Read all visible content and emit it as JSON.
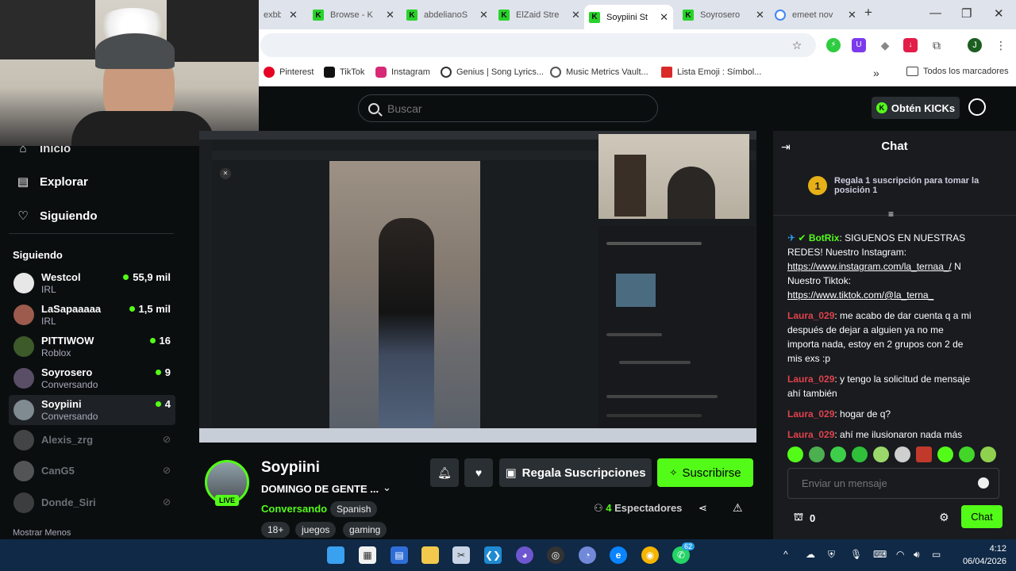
{
  "browser": {
    "tabs": [
      {
        "title": "exbb",
        "favicon": "none"
      },
      {
        "title": "Browse - K",
        "favicon": "kick"
      },
      {
        "title": "abdelianoS",
        "favicon": "kick"
      },
      {
        "title": "ElZaid Stre",
        "favicon": "kick"
      },
      {
        "title": "Soypiini St",
        "favicon": "kick",
        "active": true
      },
      {
        "title": "Soyrosero",
        "favicon": "kick"
      },
      {
        "title": "emeet nov",
        "favicon": "google"
      }
    ],
    "new_tab_label": "+",
    "bookmarks": [
      {
        "label": "Pinterest",
        "color": "#e60023"
      },
      {
        "label": "TikTok",
        "color": "#111111"
      },
      {
        "label": "Instagram",
        "color": "#d62976"
      },
      {
        "label": "Genius | Song Lyrics...",
        "color": "#333333"
      },
      {
        "label": "Music Metrics Vault...",
        "color": "#555555"
      },
      {
        "label": "Lista Emoji : Símbol...",
        "color": "#d92a2a"
      }
    ],
    "all_bookmarks_label": "Todos los marcadores",
    "profile_initial": "J"
  },
  "header": {
    "search_placeholder": "Buscar",
    "kicks_button": "Obtén KICKs"
  },
  "sidebar": {
    "nav": [
      {
        "label": "Inicio"
      },
      {
        "label": "Explorar"
      },
      {
        "label": "Siguiendo"
      }
    ],
    "following_title": "Siguiendo",
    "channels": [
      {
        "name": "Westcol",
        "category": "IRL",
        "viewers": "55,9 mil",
        "online": true
      },
      {
        "name": "LaSapaaaaa",
        "category": "IRL",
        "viewers": "1,5 mil",
        "online": true
      },
      {
        "name": "PITTIWOW",
        "category": "Roblox",
        "viewers": "16",
        "online": true
      },
      {
        "name": "Soyrosero",
        "category": "Conversando",
        "viewers": "9",
        "online": true
      },
      {
        "name": "Soypiini",
        "category": "Conversando",
        "viewers": "4",
        "online": true,
        "selected": true
      },
      {
        "name": "Alexis_zrg",
        "online": false
      },
      {
        "name": "CanG5",
        "online": false
      },
      {
        "name": "Donde_Siri",
        "online": false
      }
    ],
    "show_less": "Mostrar Menos"
  },
  "stream": {
    "streamer": "Soypiini",
    "title": "DOMINGO DE GENTE ...",
    "live_badge": "LIVE",
    "category": "Conversando",
    "tags": [
      "Spanish",
      "18+",
      "juegos",
      "gaming"
    ],
    "gift_button": "Regala Suscripciones",
    "subscribe_button": "Suscribirse",
    "viewers_count": "4",
    "viewers_label": "Espectadores"
  },
  "chat": {
    "title": "Chat",
    "gift_banner": {
      "rank": "1",
      "text": "Regala 1 suscripción para tomar la posición 1"
    },
    "messages": [
      {
        "user": "BotRix",
        "user_color": "#53fc18",
        "text": "SIGUENOS EN NUESTRAS REDES! Nuestro Instagram:",
        "link1": "https://www.instagram.com/la_ternaa_/",
        "mid": "N Nuestro Tiktok:",
        "link2": "https://www.tiktok.com/@la_terna_"
      },
      {
        "user": "Laura_029",
        "user_color": "#e0424c",
        "text": "me acabo de dar cuenta q a mi después de dejar a alguien ya no me importa nada, estoy en 2 grupos con 2 de mis exs :p"
      },
      {
        "user": "Laura_029",
        "user_color": "#e0424c",
        "text": "y tengo la solicitud de mensaje ahí también"
      },
      {
        "user": "Laura_029",
        "user_color": "#e0424c",
        "text": "hogar de q?"
      },
      {
        "user": "Laura_029",
        "user_color": "#e0424c",
        "text": "ahí me ilusionaron nada más"
      }
    ],
    "input_placeholder": "Enviar un mensaje",
    "points": "0",
    "send_button": "Chat"
  },
  "taskbar": {
    "time": "4:12",
    "date": "06/04/2026",
    "badge_count": "62"
  }
}
